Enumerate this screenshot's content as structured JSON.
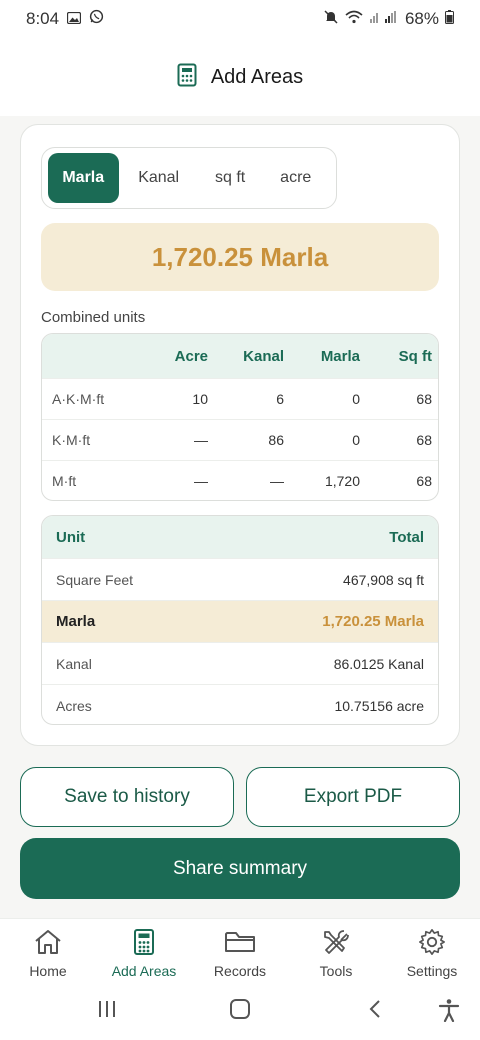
{
  "status": {
    "time": "8:04",
    "battery": "68%"
  },
  "header": {
    "title": "Add Areas"
  },
  "unit_tabs": [
    {
      "label": "Marla",
      "active": true
    },
    {
      "label": "Kanal",
      "active": false
    },
    {
      "label": "sq ft",
      "active": false
    },
    {
      "label": "acre",
      "active": false
    }
  ],
  "result": "1,720.25 Marla",
  "combined": {
    "label": "Combined units",
    "headers": [
      "",
      "Acre",
      "Kanal",
      "Marla",
      "Sq ft"
    ],
    "rows": [
      [
        "A·K·M·ft",
        "10",
        "6",
        "0",
        "68"
      ],
      [
        "K·M·ft",
        "—",
        "86",
        "0",
        "68"
      ],
      [
        "M·ft",
        "—",
        "—",
        "1,720",
        "68"
      ]
    ]
  },
  "totals": {
    "headers": [
      "Unit",
      "Total"
    ],
    "rows": [
      {
        "unit": "Square Feet",
        "value": "467,908 sq ft"
      },
      {
        "unit": "Marla",
        "value": "1,720.25 Marla"
      },
      {
        "unit": "Kanal",
        "value": "86.0125 Kanal"
      },
      {
        "unit": "Acres",
        "value": "10.75156 acre"
      }
    ]
  },
  "actions": {
    "save": "Save to history",
    "export": "Export PDF",
    "share": "Share summary"
  },
  "nav": [
    {
      "label": "Home",
      "icon": "home-icon"
    },
    {
      "label": "Add Areas",
      "icon": "calculator-icon"
    },
    {
      "label": "Records",
      "icon": "folder-icon"
    },
    {
      "label": "Tools",
      "icon": "tools-icon"
    },
    {
      "label": "Settings",
      "icon": "gear-icon"
    }
  ],
  "colors": {
    "primary": "#1b6b55",
    "accent": "#c9913b",
    "highlight": "#f5ecd6",
    "header_bg": "#e8f3ee"
  }
}
